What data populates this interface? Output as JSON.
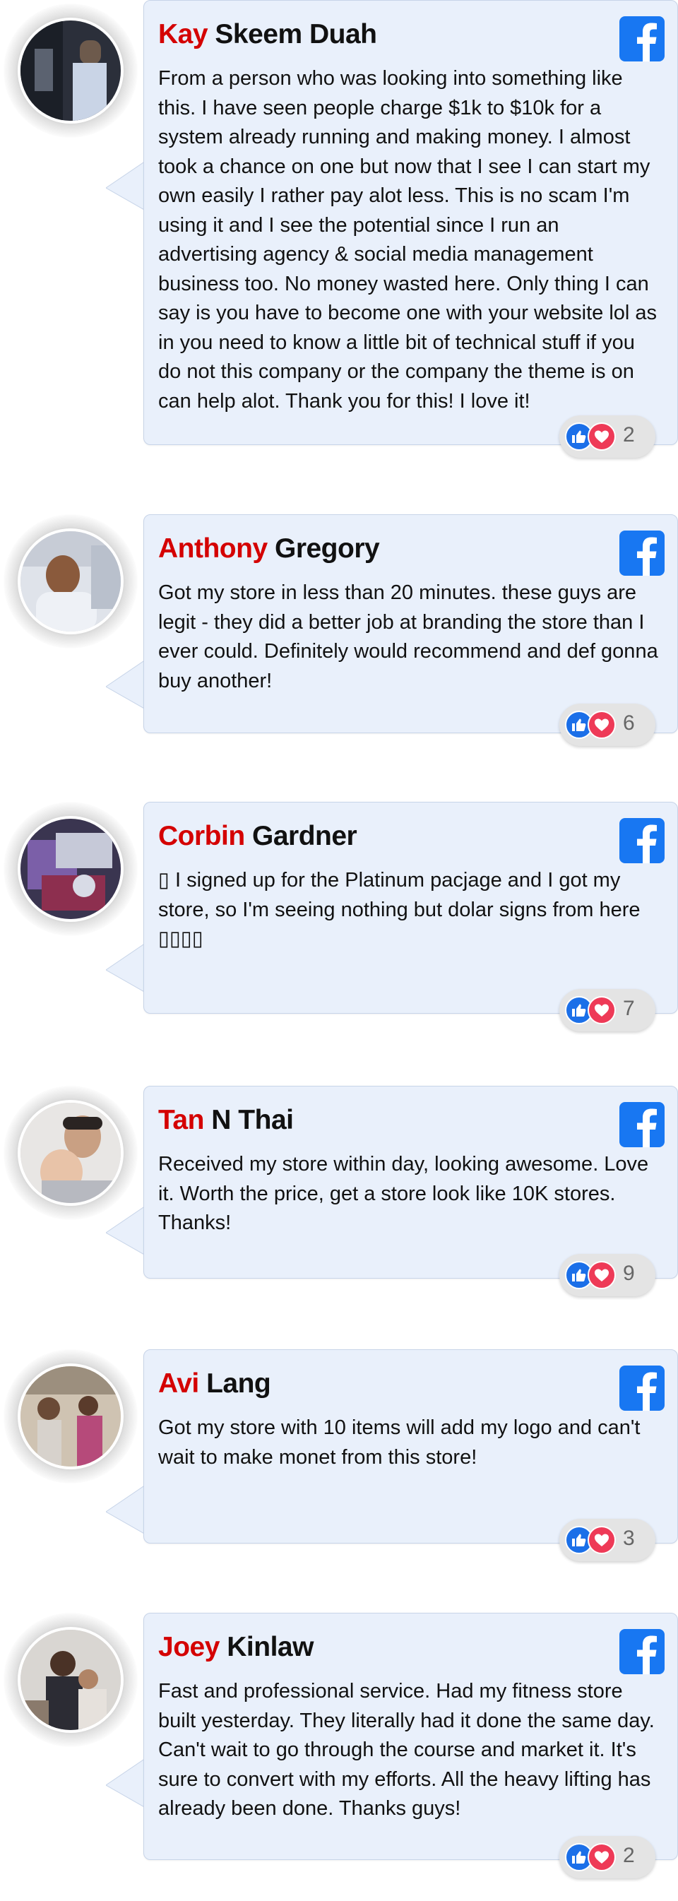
{
  "reviews": [
    {
      "first_name": "Kay",
      "last_name": "Skeem Duah",
      "text": "From a person who was looking into something like this. I have seen people charge $1k to $10k for a system already running and making money. I almost took a chance on one but now that I see I can start my own easily I rather pay alot less. This is no scam I'm using it and I see the potential since I run an advertising agency & social media management business too. No money wasted here. Only thing I can say is you have to become one with your website lol as in you need to know a little bit of technical stuff if you do not this company or the company the theme is on can help alot. Thank you for this! I love it!",
      "reaction_count": "2"
    },
    {
      "first_name": "Anthony",
      "last_name": "Gregory",
      "text": "Got my store in less than 20 minutes. these guys are legit - they did a better job at branding the store than I ever could. Definitely would recommend and def gonna buy another!",
      "reaction_count": "6"
    },
    {
      "first_name": "Corbin",
      "last_name": "Gardner",
      "text": "▯ I signed up for the Platinum pacjage and I got my store, so I'm seeing nothing but dolar signs from here ▯▯▯▯",
      "reaction_count": "7"
    },
    {
      "first_name": "Tan",
      "last_name": "N Thai",
      "text": "Received my store within day, looking awesome. Love it. Worth the price, get a store look like 10K stores. Thanks!",
      "reaction_count": "9"
    },
    {
      "first_name": "Avi",
      "last_name": "Lang",
      "text": "Got my store with 10 items will add my logo and can't wait to make monet from this store!",
      "reaction_count": "3"
    },
    {
      "first_name": "Joey",
      "last_name": "Kinlaw",
      "text": "Fast and professional service. Had my fitness store built yesterday. They literally had it done the same day. Can't wait to go through the course and market it. It's sure to convert with my efforts. All the heavy lifting has already been done. Thanks guys!",
      "reaction_count": "2"
    }
  ],
  "icons": {
    "platform": "facebook-icon",
    "reactions": [
      "like-icon",
      "heart-icon"
    ]
  },
  "colors": {
    "first_name": "#d40000",
    "bubble_bg": "#e9f0fb",
    "facebook_blue": "#1877f2",
    "like_blue": "#1b6fe8",
    "heart_red": "#ee3a57"
  }
}
